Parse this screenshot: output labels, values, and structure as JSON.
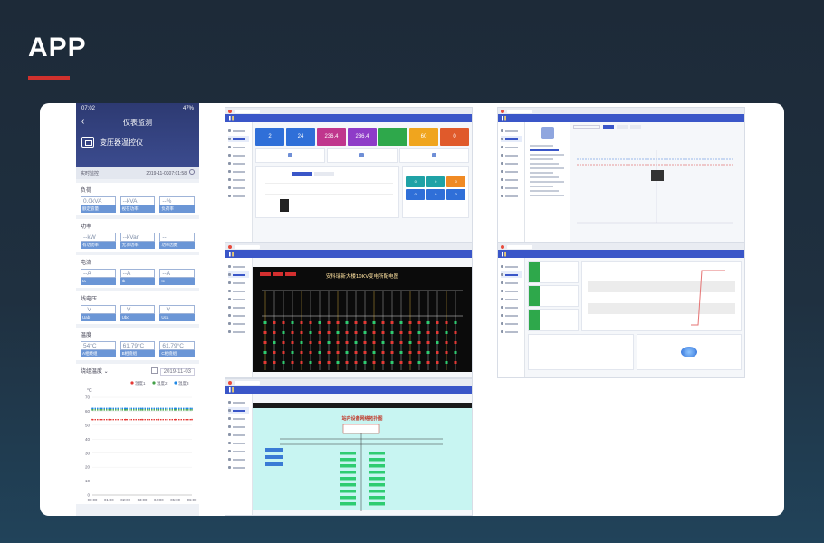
{
  "header": {
    "title": "APP"
  },
  "phone": {
    "status_time": "07:02",
    "status_right": "47%",
    "nav_title": "仪表监测",
    "device_name": "变压器温控仪",
    "realtime_label": "实时监控",
    "realtime_time": "2019-11-0307:01:58",
    "groups": [
      {
        "title": "负荷",
        "cells": [
          {
            "value": "0.0kVA",
            "label": "额定容量"
          },
          {
            "value": "--kVA",
            "label": "视在功率"
          },
          {
            "value": "--%",
            "label": "负荷率"
          }
        ]
      },
      {
        "title": "功率",
        "cells": [
          {
            "value": "--kW",
            "label": "有功功率"
          },
          {
            "value": "--kVar",
            "label": "无功功率"
          },
          {
            "value": "--",
            "label": "功率因数"
          }
        ]
      },
      {
        "title": "电流",
        "cells": [
          {
            "value": "--A",
            "label": "Ia"
          },
          {
            "value": "--A",
            "label": "Ib"
          },
          {
            "value": "--A",
            "label": "Ic"
          }
        ]
      },
      {
        "title": "线电压",
        "cells": [
          {
            "value": "--V",
            "label": "Uab"
          },
          {
            "value": "--V",
            "label": "Ubc"
          },
          {
            "value": "--V",
            "label": "Uca"
          }
        ]
      },
      {
        "title": "温度",
        "cells": [
          {
            "value": "54°C",
            "label": "A相绕组"
          },
          {
            "value": "61.79°C",
            "label": "B相绕组"
          },
          {
            "value": "61.79°C",
            "label": "C相绕组"
          }
        ]
      }
    ],
    "trend_select": "绕组温度",
    "trend_date": "2019-11-03",
    "legend": [
      "温度1",
      "温度2",
      "温度3"
    ],
    "legend_colors": [
      "#e53935",
      "#43a047",
      "#1e88e5"
    ],
    "unit": "°C"
  },
  "chart_data": {
    "type": "line",
    "ylabel": "°C",
    "ylim": [
      0,
      70
    ],
    "yticks": [
      0,
      10,
      20,
      30,
      40,
      50,
      60,
      70
    ],
    "categories": [
      "00:00",
      "01:00",
      "02:00",
      "03:00",
      "04:00",
      "05:00",
      "06:00"
    ],
    "series": [
      {
        "name": "温度1",
        "color": "#e53935",
        "values": [
          54,
          54,
          54,
          54,
          54,
          54,
          54
        ]
      },
      {
        "name": "温度2",
        "color": "#43a047",
        "values": [
          61,
          61,
          61,
          61,
          61,
          61,
          61
        ]
      },
      {
        "name": "温度3",
        "color": "#1e88e5",
        "values": [
          62,
          62,
          62,
          62,
          62,
          62,
          62
        ]
      }
    ]
  },
  "dashboard": {
    "tiles": [
      {
        "value": "2",
        "color": "#2f6fd8"
      },
      {
        "value": "24",
        "color": "#2f6fd8"
      },
      {
        "value": "236.4",
        "color": "#c0368d"
      },
      {
        "value": "236.4",
        "color": "#8e3cc8"
      },
      {
        "value": "",
        "color": "#2ea84b"
      },
      {
        "value": "60",
        "color": "#f0a51e"
      },
      {
        "value": "0",
        "color": "#e05a2b"
      }
    ],
    "squares": [
      {
        "value": "0",
        "color": "#1fa2a6"
      },
      {
        "value": "0",
        "color": "#1fa2a6"
      },
      {
        "value": "0",
        "color": "#f08a24"
      },
      {
        "value": "0",
        "color": "#2f6fd8"
      },
      {
        "value": "0",
        "color": "#2f6fd8"
      },
      {
        "value": "0",
        "color": "#2f6fd8"
      }
    ]
  },
  "diagram_dark": {
    "title": "安科瑞新大楼10KV变电所配电图"
  },
  "diagram_cyan": {
    "title": "站内设备网络拓扑图"
  }
}
